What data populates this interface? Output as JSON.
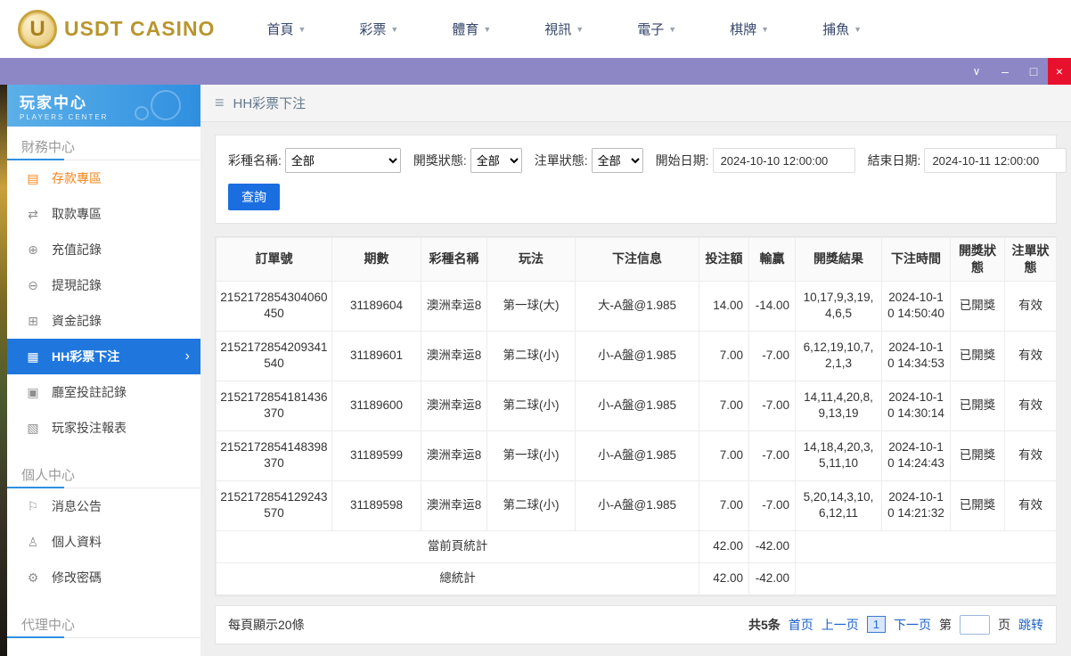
{
  "colors": {
    "brand_gold": "#b8962e",
    "titlebar_purple": "#8d87c6",
    "close_red": "#e8112d",
    "sidebar_header_blue": "#2f8fe0",
    "active_item_blue": "#1f76dd",
    "deposit_orange": "#f08519",
    "link_blue": "#1a60c8"
  },
  "icons": {
    "caret": "▼",
    "chevron": "∨",
    "minimize": "–",
    "maximize": "□",
    "close": "×",
    "hamburger": "≡",
    "arrow_right": "›",
    "logo_letter": "U",
    "deposit": "▤",
    "withdraw": "⇄",
    "topup": "⊕",
    "withdrawal": "⊖",
    "funds": "⊞",
    "lottery": "▦",
    "room": "▣",
    "report": "▧",
    "announce": "⚐",
    "profile": "♙",
    "password": "⚙"
  },
  "topnav": {
    "brand": "USDT CASINO",
    "items": [
      "首頁",
      "彩票",
      "體育",
      "視訊",
      "電子",
      "棋牌",
      "捕魚"
    ]
  },
  "sidebar": {
    "title": "玩家中心",
    "subtitle": "PLAYERS CENTER",
    "sections": [
      {
        "title": "財務中心",
        "items": [
          "存款專區",
          "取款專區",
          "充值記錄",
          "提現記錄",
          "資金記錄",
          "HH彩票下注",
          "廳室投註記錄",
          "玩家投注報表"
        ]
      },
      {
        "title": "個人中心",
        "items": [
          "消息公告",
          "個人資料",
          "修改密碼"
        ]
      },
      {
        "title": "代理中心",
        "items": []
      }
    ]
  },
  "page": {
    "title": "HH彩票下注"
  },
  "filters": {
    "lottery_label": "彩種名稱:",
    "lottery_value": "全部",
    "draw_status_label": "開獎狀態:",
    "draw_status_value": "全部",
    "order_status_label": "注單狀態:",
    "order_status_value": "全部",
    "start_label": "開始日期:",
    "start_value": "2024-10-10 12:00:00",
    "end_label": "結束日期:",
    "end_value": "2024-10-11 12:00:00",
    "search_button": "查詢"
  },
  "table": {
    "headers": [
      "訂單號",
      "期數",
      "彩種名稱",
      "玩法",
      "下注信息",
      "投注額",
      "輸贏",
      "開獎結果",
      "下注時間",
      "開獎狀態",
      "注單狀態"
    ],
    "rows": [
      {
        "order_id": "2152172854304060450",
        "period": "31189604",
        "lottery": "澳洲幸运8",
        "play": "第一球(大)",
        "bet_info": "大-A盤@1.985",
        "amount": "14.00",
        "win_loss": "-14.00",
        "result": "10,17,9,3,19,4,6,5",
        "bet_time": "2024-10-10 14:50:40",
        "draw_status": "已開獎",
        "order_status": "有效"
      },
      {
        "order_id": "2152172854209341540",
        "period": "31189601",
        "lottery": "澳洲幸运8",
        "play": "第二球(小)",
        "bet_info": "小-A盤@1.985",
        "amount": "7.00",
        "win_loss": "-7.00",
        "result": "6,12,19,10,7,2,1,3",
        "bet_time": "2024-10-10 14:34:53",
        "draw_status": "已開獎",
        "order_status": "有效"
      },
      {
        "order_id": "2152172854181436370",
        "period": "31189600",
        "lottery": "澳洲幸运8",
        "play": "第二球(小)",
        "bet_info": "小-A盤@1.985",
        "amount": "7.00",
        "win_loss": "-7.00",
        "result": "14,11,4,20,8,9,13,19",
        "bet_time": "2024-10-10 14:30:14",
        "draw_status": "已開獎",
        "order_status": "有效"
      },
      {
        "order_id": "2152172854148398370",
        "period": "31189599",
        "lottery": "澳洲幸运8",
        "play": "第一球(小)",
        "bet_info": "小-A盤@1.985",
        "amount": "7.00",
        "win_loss": "-7.00",
        "result": "14,18,4,20,3,5,11,10",
        "bet_time": "2024-10-10 14:24:43",
        "draw_status": "已開獎",
        "order_status": "有效"
      },
      {
        "order_id": "2152172854129243570",
        "period": "31189598",
        "lottery": "澳洲幸运8",
        "play": "第二球(小)",
        "bet_info": "小-A盤@1.985",
        "amount": "7.00",
        "win_loss": "-7.00",
        "result": "5,20,14,3,10,6,12,11",
        "bet_time": "2024-10-10 14:21:32",
        "draw_status": "已開獎",
        "order_status": "有效"
      }
    ],
    "page_total": {
      "label": "當前頁統計",
      "amount": "42.00",
      "win_loss": "-42.00"
    },
    "grand_total": {
      "label": "總統計",
      "amount": "42.00",
      "win_loss": "-42.00"
    }
  },
  "footer": {
    "page_size": "每頁顯示20條",
    "total": "共5条",
    "first": "首页",
    "prev": "上一页",
    "current": "1",
    "next": "下一页",
    "jump_pre": "第",
    "jump_post": "页",
    "jump": "跳转"
  }
}
